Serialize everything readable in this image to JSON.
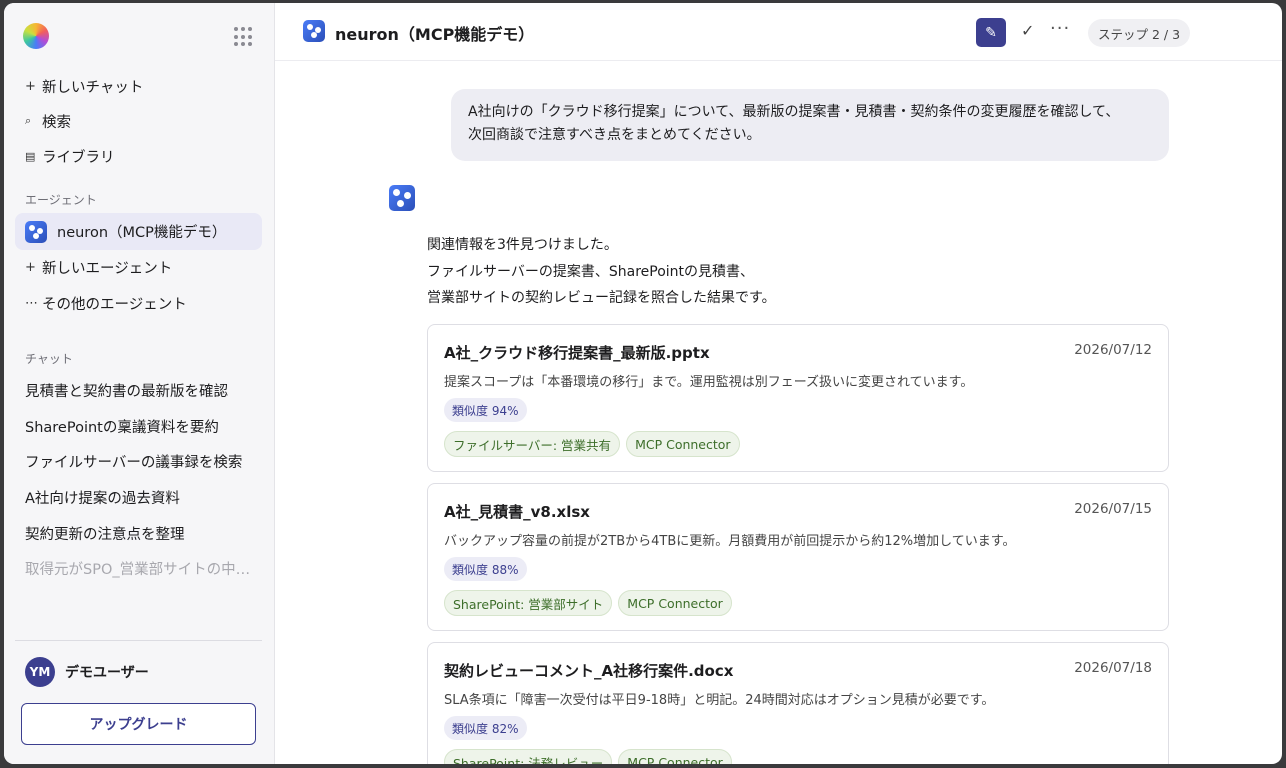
{
  "sidebar": {
    "new_chat": "新しいチャット",
    "search": "検索",
    "library": "ライブラリ",
    "agents_label": "エージェント",
    "active_agent": "neuron（MCP機能デモ）",
    "new_agent": "新しいエージェント",
    "other_agents": "その他のエージェント",
    "chats_label": "チャット",
    "chats": [
      "見積書と契約書の最新版を確認",
      "SharePointの稟議資料を要約",
      "ファイルサーバーの議事録を検索",
      "A社向け提案の過去資料",
      "契約更新の注意点を整理",
      "取得元がSPO_営業部サイトの中…"
    ],
    "user_initials": "YM",
    "user_name": "デモユーザー",
    "upgrade": "アップグレード"
  },
  "header": {
    "title": "neuron（MCP機能デモ）",
    "step": "ステップ 2 / 3"
  },
  "conversation": {
    "user_message_line1": "A社向けの「クラウド移行提案」について、最新版の提案書・見積書・契約条件の変更履歴を確認して、",
    "user_message_line2": "次回商談で注意すべき点をまとめてください。",
    "bot_line1": "関連情報を3件見つけました。",
    "bot_line2": "ファイルサーバーの提案書、SharePointの見積書、",
    "bot_line3": "営業部サイトの契約レビュー記録を照合した結果です。"
  },
  "results": [
    {
      "title": "A社_クラウド移行提案書_最新版.pptx",
      "date": "2026/07/12",
      "desc": "提案スコープは「本番環境の移行」まで。運用監視は別フェーズ扱いに変更されています。",
      "similarity": "類似度 94%",
      "tags": [
        "ファイルサーバー: 営業共有",
        "MCP Connector"
      ]
    },
    {
      "title": "A社_見積書_v8.xlsx",
      "date": "2026/07/15",
      "desc": "バックアップ容量の前提が2TBから4TBに更新。月額費用が前回提示から約12%増加しています。",
      "similarity": "類似度 88%",
      "tags": [
        "SharePoint: 営業部サイト",
        "MCP Connector"
      ]
    },
    {
      "title": "契約レビューコメント_A社移行案件.docx",
      "date": "2026/07/18",
      "desc": "SLA条項に「障害一次受付は平日9-18時」と明記。24時間対応はオプション見積が必要です。",
      "similarity": "類似度 82%",
      "tags": [
        "SharePoint: 法務レビュー",
        "MCP Connector"
      ]
    }
  ]
}
